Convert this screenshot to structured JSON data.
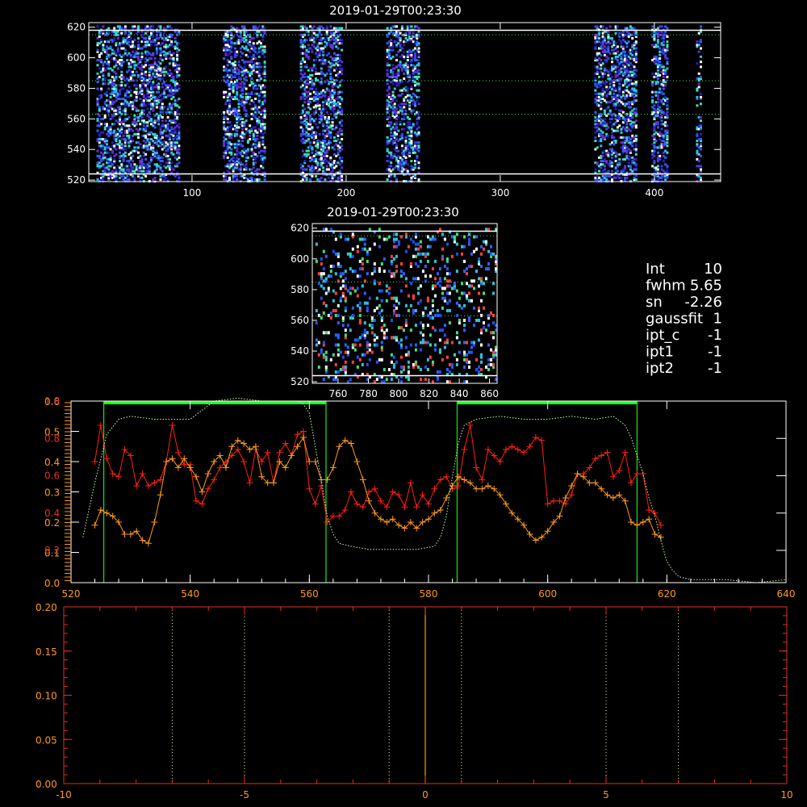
{
  "chart_data": [
    {
      "id": "top",
      "type": "heatmap",
      "title": "2019-01-29T00:23:30",
      "xlim": [
        33,
        443
      ],
      "ylim": [
        519,
        623
      ],
      "xticks": [
        100,
        200,
        300,
        400
      ],
      "yticks": [
        520,
        540,
        560,
        580,
        600,
        620
      ],
      "hlines_solid": [
        524,
        618
      ],
      "hlines_dotted": [
        563,
        585,
        615
      ],
      "columns": [
        [
          38,
          92
        ],
        [
          120,
          147
        ],
        [
          170,
          197
        ],
        [
          226,
          247
        ],
        [
          361,
          388
        ],
        [
          398,
          408
        ],
        [
          427,
          430
        ]
      ],
      "colors": [
        "#2020c0",
        "#4040e0",
        "#6a2ad0",
        "#3060ff",
        "#30c0e0",
        "#40e0c0",
        "#ffffff"
      ]
    },
    {
      "id": "mid",
      "type": "heatmap",
      "title": "2019-01-29T00:23:30",
      "xlim": [
        743,
        865
      ],
      "ylim": [
        519,
        623
      ],
      "xticks": [
        760,
        780,
        800,
        820,
        840,
        860
      ],
      "yticks": [
        520,
        540,
        560,
        580,
        600,
        620
      ],
      "hlines_solid": [
        524,
        618
      ],
      "hlines_dotted": [
        563,
        585,
        615
      ],
      "colors": [
        "#3060ff",
        "#2050f0",
        "#30c0e0",
        "#40e080",
        "#ff4040",
        "#ffffff"
      ]
    },
    {
      "id": "profile",
      "type": "line",
      "xlim": [
        520,
        640
      ],
      "ylim": [
        0,
        0.6
      ],
      "xticks": [
        520,
        540,
        560,
        580,
        600,
        620,
        640
      ],
      "yticks_left": [
        "0.0",
        "0.1",
        "0.2",
        "0.3",
        "0.4",
        "0.5",
        "0.6"
      ],
      "yticks_left_outer": [
        "0.2",
        "0.4",
        "0.6",
        "0.8",
        "1.0"
      ],
      "windows": [
        [
          525.5,
          562.8
        ],
        [
          584.8,
          615.0
        ]
      ],
      "series": [
        {
          "color": "#ff2010",
          "x": [
            524,
            525,
            526,
            527,
            528,
            529,
            530,
            531,
            532,
            533,
            534,
            535,
            536,
            537,
            538,
            539,
            540,
            541,
            542,
            543,
            544,
            545,
            546,
            547,
            548,
            549,
            550,
            551,
            552,
            553,
            554,
            555,
            556,
            557,
            558,
            559,
            560,
            561,
            562,
            563,
            564,
            565,
            566,
            567,
            568,
            569,
            570,
            571,
            572,
            573,
            574,
            575,
            576,
            577,
            578,
            579,
            580,
            581,
            582,
            583,
            584,
            585,
            586,
            587,
            588,
            589,
            590,
            591,
            592,
            593,
            594,
            595,
            596,
            597,
            598,
            599,
            600,
            601,
            602,
            603,
            604,
            605,
            606,
            607,
            608,
            609,
            610,
            611,
            612,
            613,
            614,
            615,
            616,
            617,
            618,
            619
          ],
          "y": [
            0.4,
            0.52,
            0.41,
            0.36,
            0.35,
            0.44,
            0.42,
            0.32,
            0.36,
            0.32,
            0.33,
            0.34,
            0.4,
            0.52,
            0.43,
            0.39,
            0.39,
            0.27,
            0.26,
            0.31,
            0.34,
            0.38,
            0.4,
            0.42,
            0.44,
            0.4,
            0.33,
            0.44,
            0.4,
            0.43,
            0.33,
            0.43,
            0.46,
            0.42,
            0.49,
            0.5,
            0.31,
            0.26,
            0.32,
            0.2,
            0.22,
            0.22,
            0.24,
            0.3,
            0.26,
            0.25,
            0.3,
            0.31,
            0.27,
            0.25,
            0.3,
            0.29,
            0.25,
            0.33,
            0.25,
            0.29,
            0.26,
            0.31,
            0.34,
            0.35,
            0.31,
            0.32,
            0.44,
            0.52,
            0.38,
            0.34,
            0.44,
            0.42,
            0.4,
            0.44,
            0.45,
            0.44,
            0.43,
            0.45,
            0.48,
            0.47,
            0.26,
            0.27,
            0.27,
            0.26,
            0.29,
            0.36,
            0.36,
            0.38,
            0.41,
            0.42,
            0.43,
            0.35,
            0.37,
            0.43,
            0.33,
            0.36,
            0.36,
            0.24,
            0.23,
            0.19
          ]
        },
        {
          "color": "#ff9a1a",
          "x": [
            524,
            525,
            526,
            527,
            528,
            529,
            530,
            531,
            532,
            533,
            534,
            535,
            536,
            537,
            538,
            539,
            540,
            541,
            542,
            543,
            544,
            545,
            546,
            547,
            548,
            549,
            550,
            551,
            552,
            553,
            554,
            555,
            556,
            557,
            558,
            559,
            560,
            561,
            562,
            563,
            564,
            565,
            566,
            567,
            568,
            569,
            570,
            571,
            572,
            573,
            574,
            575,
            576,
            577,
            578,
            579,
            580,
            581,
            582,
            583,
            584,
            585,
            586,
            587,
            588,
            589,
            590,
            591,
            592,
            593,
            594,
            595,
            596,
            597,
            598,
            599,
            600,
            601,
            602,
            603,
            604,
            605,
            606,
            607,
            608,
            609,
            610,
            611,
            612,
            613,
            614,
            615,
            616,
            617,
            618,
            619
          ],
          "y": [
            0.19,
            0.24,
            0.23,
            0.22,
            0.2,
            0.16,
            0.16,
            0.17,
            0.14,
            0.13,
            0.2,
            0.29,
            0.4,
            0.41,
            0.38,
            0.41,
            0.38,
            0.35,
            0.3,
            0.36,
            0.4,
            0.42,
            0.38,
            0.45,
            0.47,
            0.46,
            0.44,
            0.45,
            0.35,
            0.33,
            0.33,
            0.4,
            0.38,
            0.42,
            0.45,
            0.48,
            0.4,
            0.4,
            0.34,
            0.34,
            0.38,
            0.45,
            0.47,
            0.46,
            0.4,
            0.34,
            0.27,
            0.23,
            0.21,
            0.2,
            0.21,
            0.19,
            0.18,
            0.2,
            0.18,
            0.2,
            0.21,
            0.23,
            0.24,
            0.28,
            0.32,
            0.35,
            0.34,
            0.33,
            0.31,
            0.31,
            0.32,
            0.31,
            0.29,
            0.26,
            0.23,
            0.21,
            0.19,
            0.16,
            0.14,
            0.15,
            0.17,
            0.2,
            0.22,
            0.28,
            0.32,
            0.36,
            0.35,
            0.33,
            0.33,
            0.31,
            0.29,
            0.28,
            0.29,
            0.27,
            0.2,
            0.19,
            0.2,
            0.21,
            0.16,
            0.15
          ]
        },
        {
          "color": "#c8ffb0",
          "style": "dotted",
          "x": [
            522,
            524,
            526,
            528,
            530,
            534,
            538,
            540,
            542,
            544,
            548,
            552,
            556,
            558,
            559,
            560,
            561,
            562,
            563,
            564,
            565,
            567,
            570,
            574,
            578,
            581,
            582,
            583,
            584,
            585,
            586,
            588,
            592,
            596,
            600,
            604,
            608,
            611,
            613,
            614,
            615,
            616,
            617,
            618,
            619,
            620,
            621,
            622,
            624,
            630,
            635,
            640
          ],
          "y": [
            0.15,
            0.33,
            0.49,
            0.54,
            0.55,
            0.54,
            0.54,
            0.54,
            0.57,
            0.6,
            0.61,
            0.6,
            0.6,
            0.6,
            0.59,
            0.56,
            0.45,
            0.34,
            0.22,
            0.16,
            0.13,
            0.12,
            0.11,
            0.11,
            0.11,
            0.12,
            0.15,
            0.22,
            0.35,
            0.46,
            0.52,
            0.54,
            0.55,
            0.54,
            0.54,
            0.55,
            0.54,
            0.55,
            0.52,
            0.48,
            0.42,
            0.36,
            0.28,
            0.22,
            0.14,
            0.07,
            0.04,
            0.02,
            0.01,
            0.01,
            0.0,
            0.01
          ]
        }
      ]
    },
    {
      "id": "bottom",
      "type": "line",
      "xlim": [
        -10,
        10
      ],
      "ylim": [
        0,
        0.2
      ],
      "xticks": [
        "-10",
        "-5",
        "0",
        "5",
        "10"
      ],
      "yticks": [
        "0.00",
        "0.05",
        "0.10",
        "0.15",
        "0.20"
      ],
      "vlines_dotted": [
        -7,
        -5,
        -1,
        1,
        5,
        7
      ],
      "vline_solid": 0
    }
  ],
  "info": [
    {
      "key": "Int",
      "val": "10"
    },
    {
      "key": "fwhm",
      "val": "5.65"
    },
    {
      "key": "sn",
      "val": "-2.26"
    },
    {
      "key": "gaussfit",
      "val": "1"
    },
    {
      "key": "ipt_c",
      "val": "-1"
    },
    {
      "key": "ipt1",
      "val": "-1"
    },
    {
      "key": "ipt2",
      "val": "-1"
    }
  ]
}
